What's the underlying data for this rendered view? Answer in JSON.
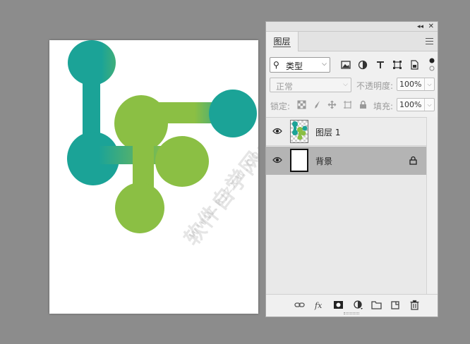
{
  "panel": {
    "tab_label": "图层",
    "filter": {
      "label": "类型",
      "icons": [
        "image-filter-icon",
        "adjustment-filter-icon",
        "type-filter-icon",
        "shape-filter-icon",
        "smart-object-filter-icon"
      ]
    },
    "blend_mode": "正常",
    "opacity_label": "不透明度:",
    "opacity_value": "100%",
    "lock_label": "锁定:",
    "fill_label": "填充:",
    "fill_value": "100%",
    "layers": [
      {
        "name": "图层 1",
        "visible": true,
        "selected": false
      },
      {
        "name": "背景",
        "visible": true,
        "selected": true,
        "locked": true
      }
    ]
  },
  "colors": {
    "teal": "#1ba397",
    "green": "#8bbf44",
    "selected_row": "#b4b4b4"
  }
}
